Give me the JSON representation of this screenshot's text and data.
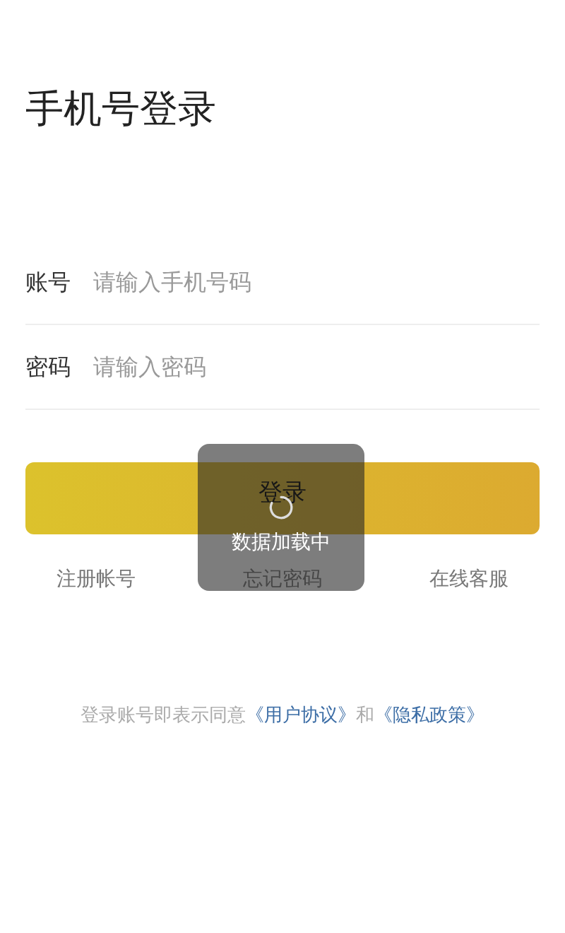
{
  "title": "手机号登录",
  "fields": [
    {
      "label": "账号",
      "placeholder": "请输入手机号码"
    },
    {
      "label": "密码",
      "placeholder": "请输入密码"
    }
  ],
  "login_button": "登录",
  "links": [
    "注册帐号",
    "忘记密码",
    "在线客服"
  ],
  "agreement": {
    "prefix": "登录账号即表示同意",
    "user_agreement": "《用户协议》",
    "conjunction": "和",
    "privacy_policy": "《隐私政策》"
  },
  "toast": {
    "text": "数据加载中"
  }
}
